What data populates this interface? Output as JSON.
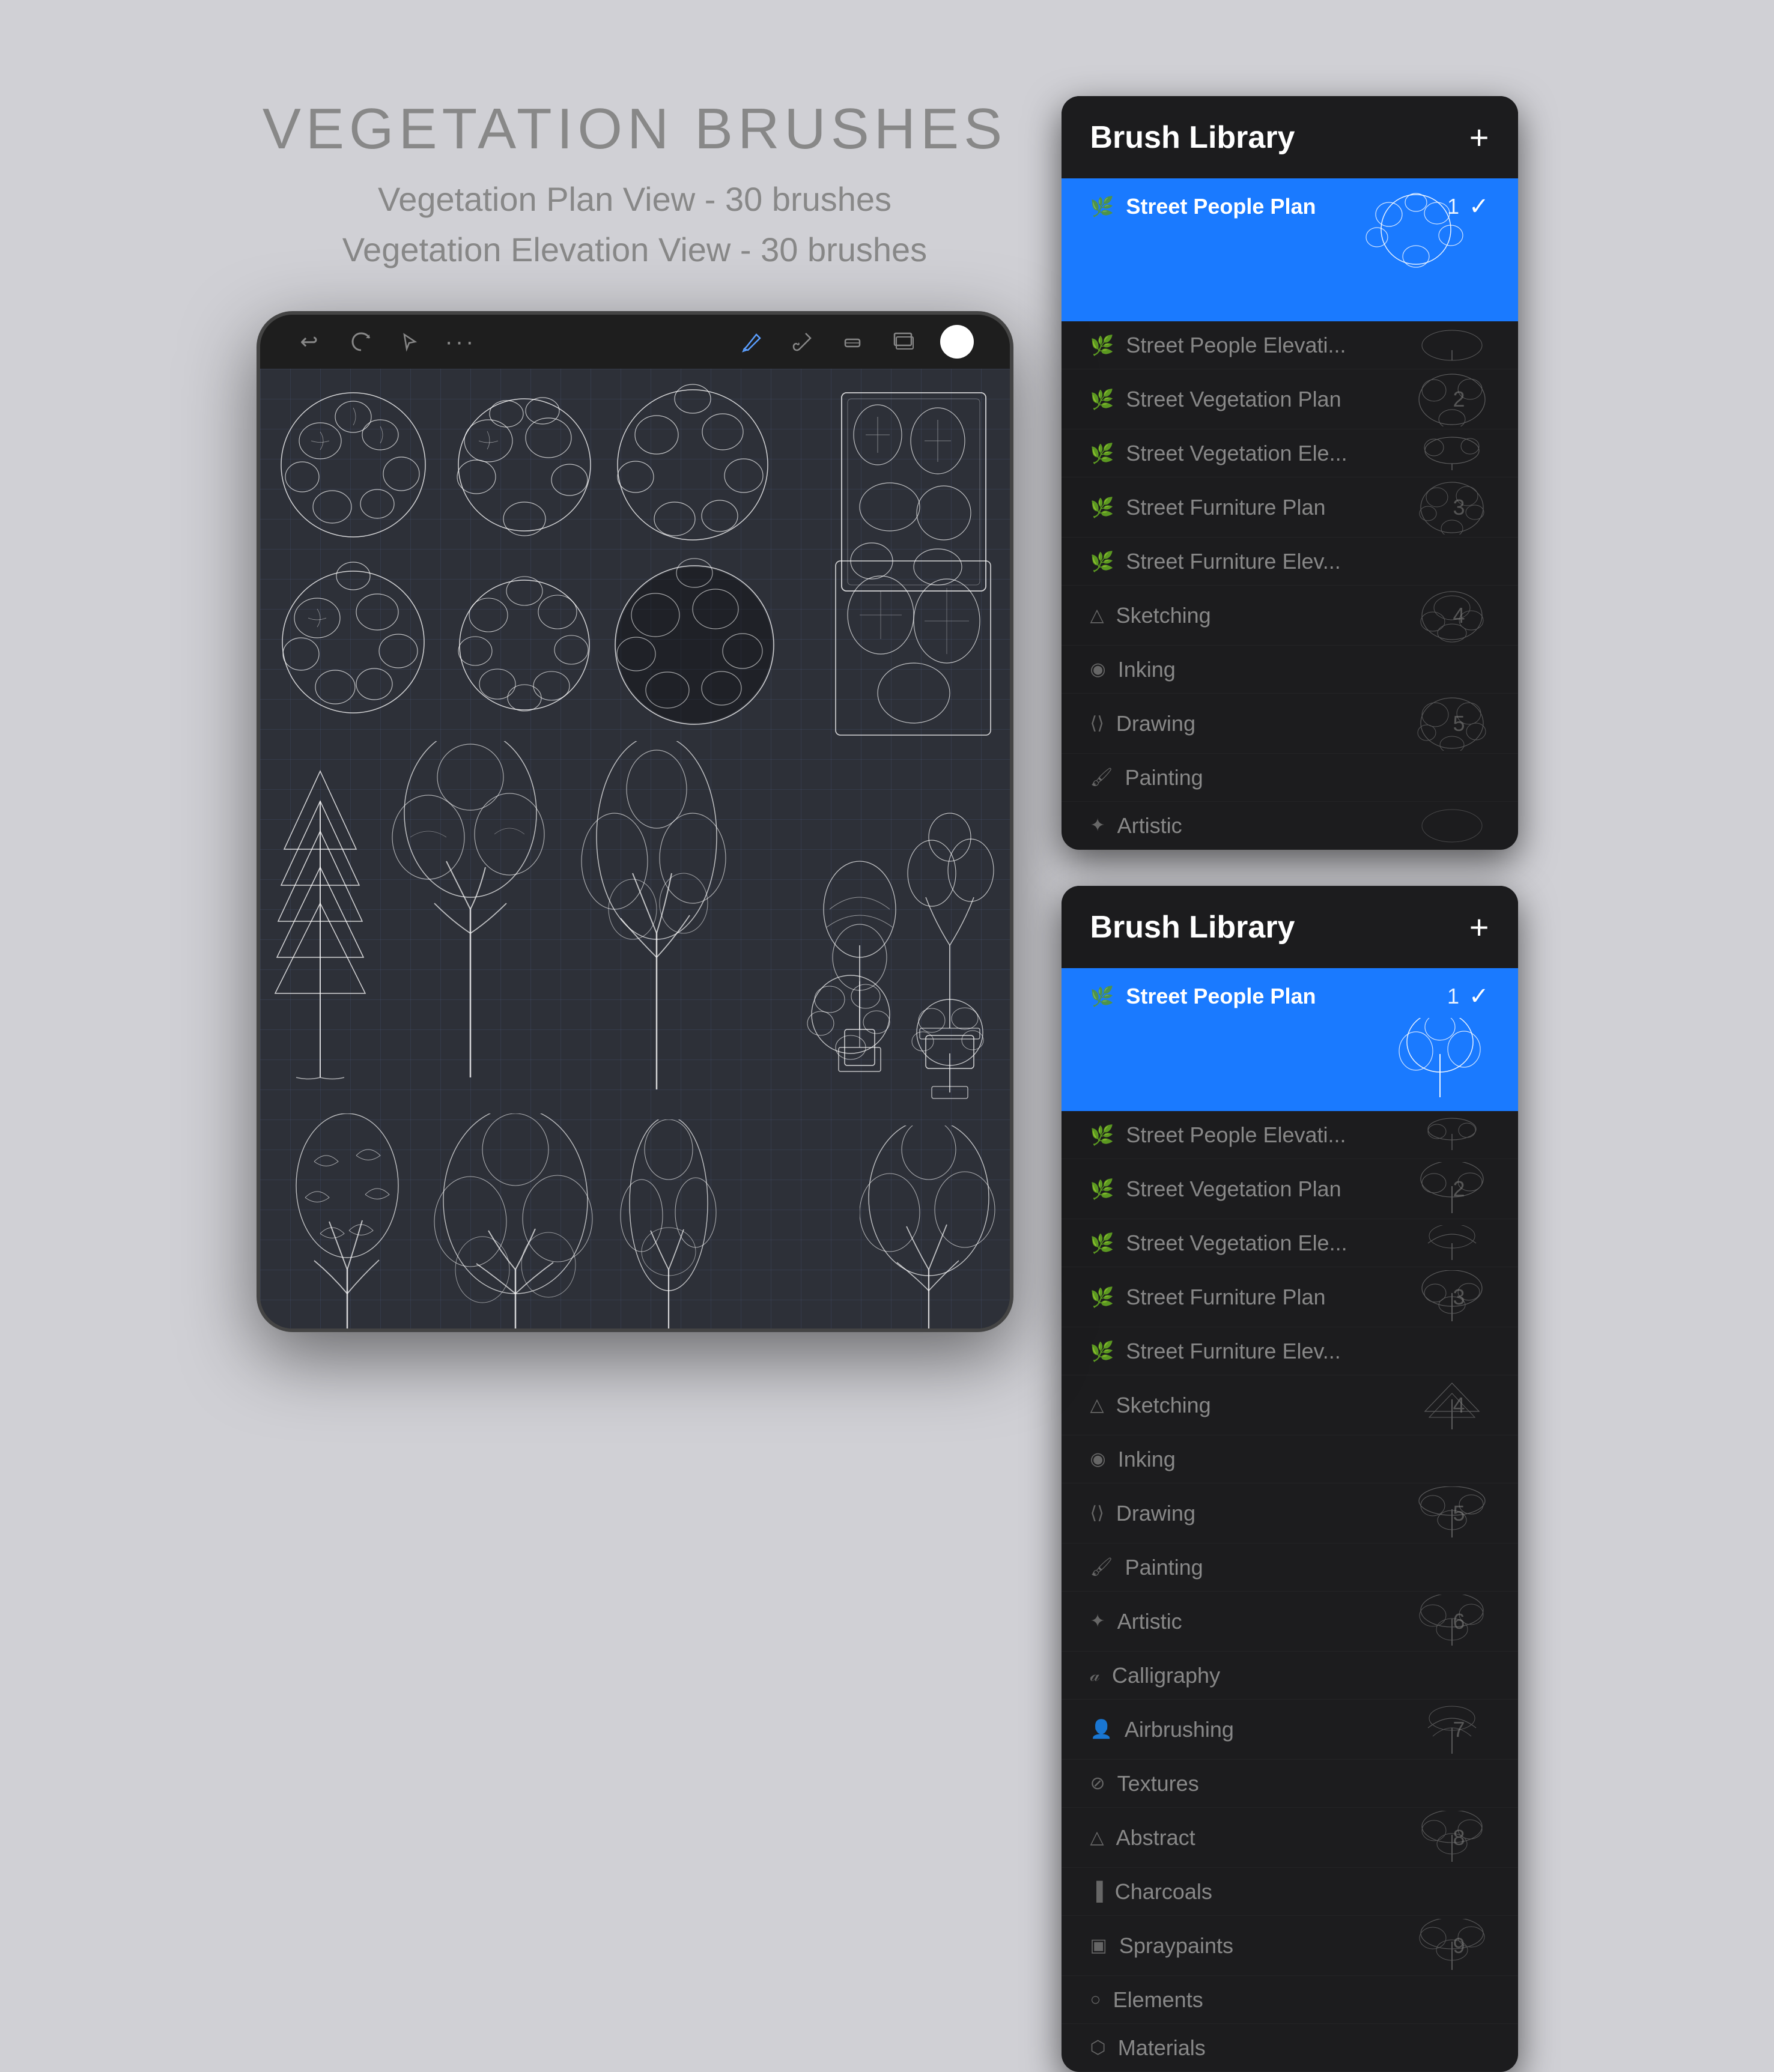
{
  "page": {
    "title": "VEGETATION BRUSHES",
    "subtitle1": "Vegetation Plan View - 30 brushes",
    "subtitle2": "Vegetation Elevation View - 30 brushes"
  },
  "brushLibrary1": {
    "header": "Brush Library",
    "plus": "+",
    "selectedBrush": "Street People Plan",
    "selectedNumber": "1",
    "categories": [
      {
        "id": "street-people-plan",
        "name": "Street People Plan",
        "number": "1",
        "selected": true,
        "icon": "leaf"
      },
      {
        "id": "street-people-elev",
        "name": "Street People Elevati...",
        "number": "",
        "selected": false,
        "icon": "leaf"
      },
      {
        "id": "street-veg-plan",
        "name": "Street Vegetation Plan",
        "number": "2",
        "selected": false,
        "icon": "leaf"
      },
      {
        "id": "street-veg-ele",
        "name": "Street Vegetation Ele...",
        "number": "",
        "selected": false,
        "icon": "leaf"
      },
      {
        "id": "street-furn-plan",
        "name": "Street Furniture Plan",
        "number": "3",
        "selected": false,
        "icon": "leaf"
      },
      {
        "id": "street-furn-ele",
        "name": "Street Furniture Elev...",
        "number": "",
        "selected": false,
        "icon": "leaf"
      },
      {
        "id": "sketching",
        "name": "Sketching",
        "number": "4",
        "selected": false,
        "icon": "pencil"
      },
      {
        "id": "inking",
        "name": "Inking",
        "number": "",
        "selected": false,
        "icon": "drop"
      },
      {
        "id": "drawing",
        "name": "Drawing",
        "number": "5",
        "selected": false,
        "icon": "pen"
      },
      {
        "id": "painting",
        "name": "Painting",
        "number": "",
        "selected": false,
        "icon": "brush"
      },
      {
        "id": "artistic",
        "name": "Artistic",
        "number": "",
        "selected": false,
        "icon": "star"
      }
    ]
  },
  "brushLibrary2": {
    "header": "Brush Library",
    "plus": "+",
    "selectedBrush": "Street People Plan",
    "selectedNumber": "1",
    "categories": [
      {
        "id": "street-people-plan2",
        "name": "Street People Plan",
        "number": "1",
        "selected": true,
        "icon": "leaf"
      },
      {
        "id": "street-people-elev2",
        "name": "Street People Elevati...",
        "number": "",
        "selected": false,
        "icon": "leaf"
      },
      {
        "id": "street-veg-plan2",
        "name": "Street Vegetation Plan",
        "number": "2",
        "selected": false,
        "icon": "leaf"
      },
      {
        "id": "street-veg-ele2",
        "name": "Street Vegetation Ele...",
        "number": "",
        "selected": false,
        "icon": "leaf"
      },
      {
        "id": "street-furn-plan2",
        "name": "Street Furniture Plan",
        "number": "3",
        "selected": false,
        "icon": "leaf"
      },
      {
        "id": "street-furn-ele2",
        "name": "Street Furniture Elev...",
        "number": "",
        "selected": false,
        "icon": "leaf"
      },
      {
        "id": "sketching2",
        "name": "Sketching",
        "number": "4",
        "selected": false,
        "icon": "pencil"
      },
      {
        "id": "inking2",
        "name": "Inking",
        "number": "",
        "selected": false,
        "icon": "drop"
      },
      {
        "id": "drawing2",
        "name": "Drawing",
        "number": "5",
        "selected": false,
        "icon": "pen"
      },
      {
        "id": "painting2",
        "name": "Painting",
        "number": "",
        "selected": false,
        "icon": "brush"
      },
      {
        "id": "artistic2",
        "name": "Artistic",
        "number": "6",
        "selected": false,
        "icon": "star"
      },
      {
        "id": "calligraphy2",
        "name": "Calligraphy",
        "number": "",
        "selected": false,
        "icon": "a"
      },
      {
        "id": "airbrushing2",
        "name": "Airbrushing",
        "number": "7",
        "selected": false,
        "icon": "person"
      },
      {
        "id": "textures2",
        "name": "Textures",
        "number": "",
        "selected": false,
        "icon": "slash"
      },
      {
        "id": "abstract2",
        "name": "Abstract",
        "number": "8",
        "selected": false,
        "icon": "triangle"
      },
      {
        "id": "charcoals2",
        "name": "Charcoals",
        "number": "",
        "selected": false,
        "icon": "bars"
      },
      {
        "id": "spraypaints2",
        "name": "Spraypaints",
        "number": "9",
        "selected": false,
        "icon": "rect"
      },
      {
        "id": "elements2",
        "name": "Elements",
        "number": "",
        "selected": false,
        "icon": "circle"
      },
      {
        "id": "materials2",
        "name": "Materials",
        "number": "",
        "selected": false,
        "icon": "hex"
      }
    ]
  },
  "icons": {
    "leaf": "🌿",
    "pencil": "✏",
    "drop": "💧",
    "pen": "🖊",
    "brush": "🖌",
    "star": "✦",
    "a": "𝒶",
    "person": "👤",
    "slash": "⊘",
    "triangle": "△",
    "bars": "▐",
    "rect": "▣",
    "circle": "○",
    "hex": "⬡"
  },
  "toolbar": {
    "undoLabel": "↩",
    "redoLabel": "↻",
    "pointerLabel": "↗",
    "dotsLabel": "•••",
    "pencilLabel": "✏",
    "brushLabel": "⟨/⟩",
    "eraserLabel": "◈",
    "layersLabel": "⧉",
    "colorLabel": ""
  }
}
